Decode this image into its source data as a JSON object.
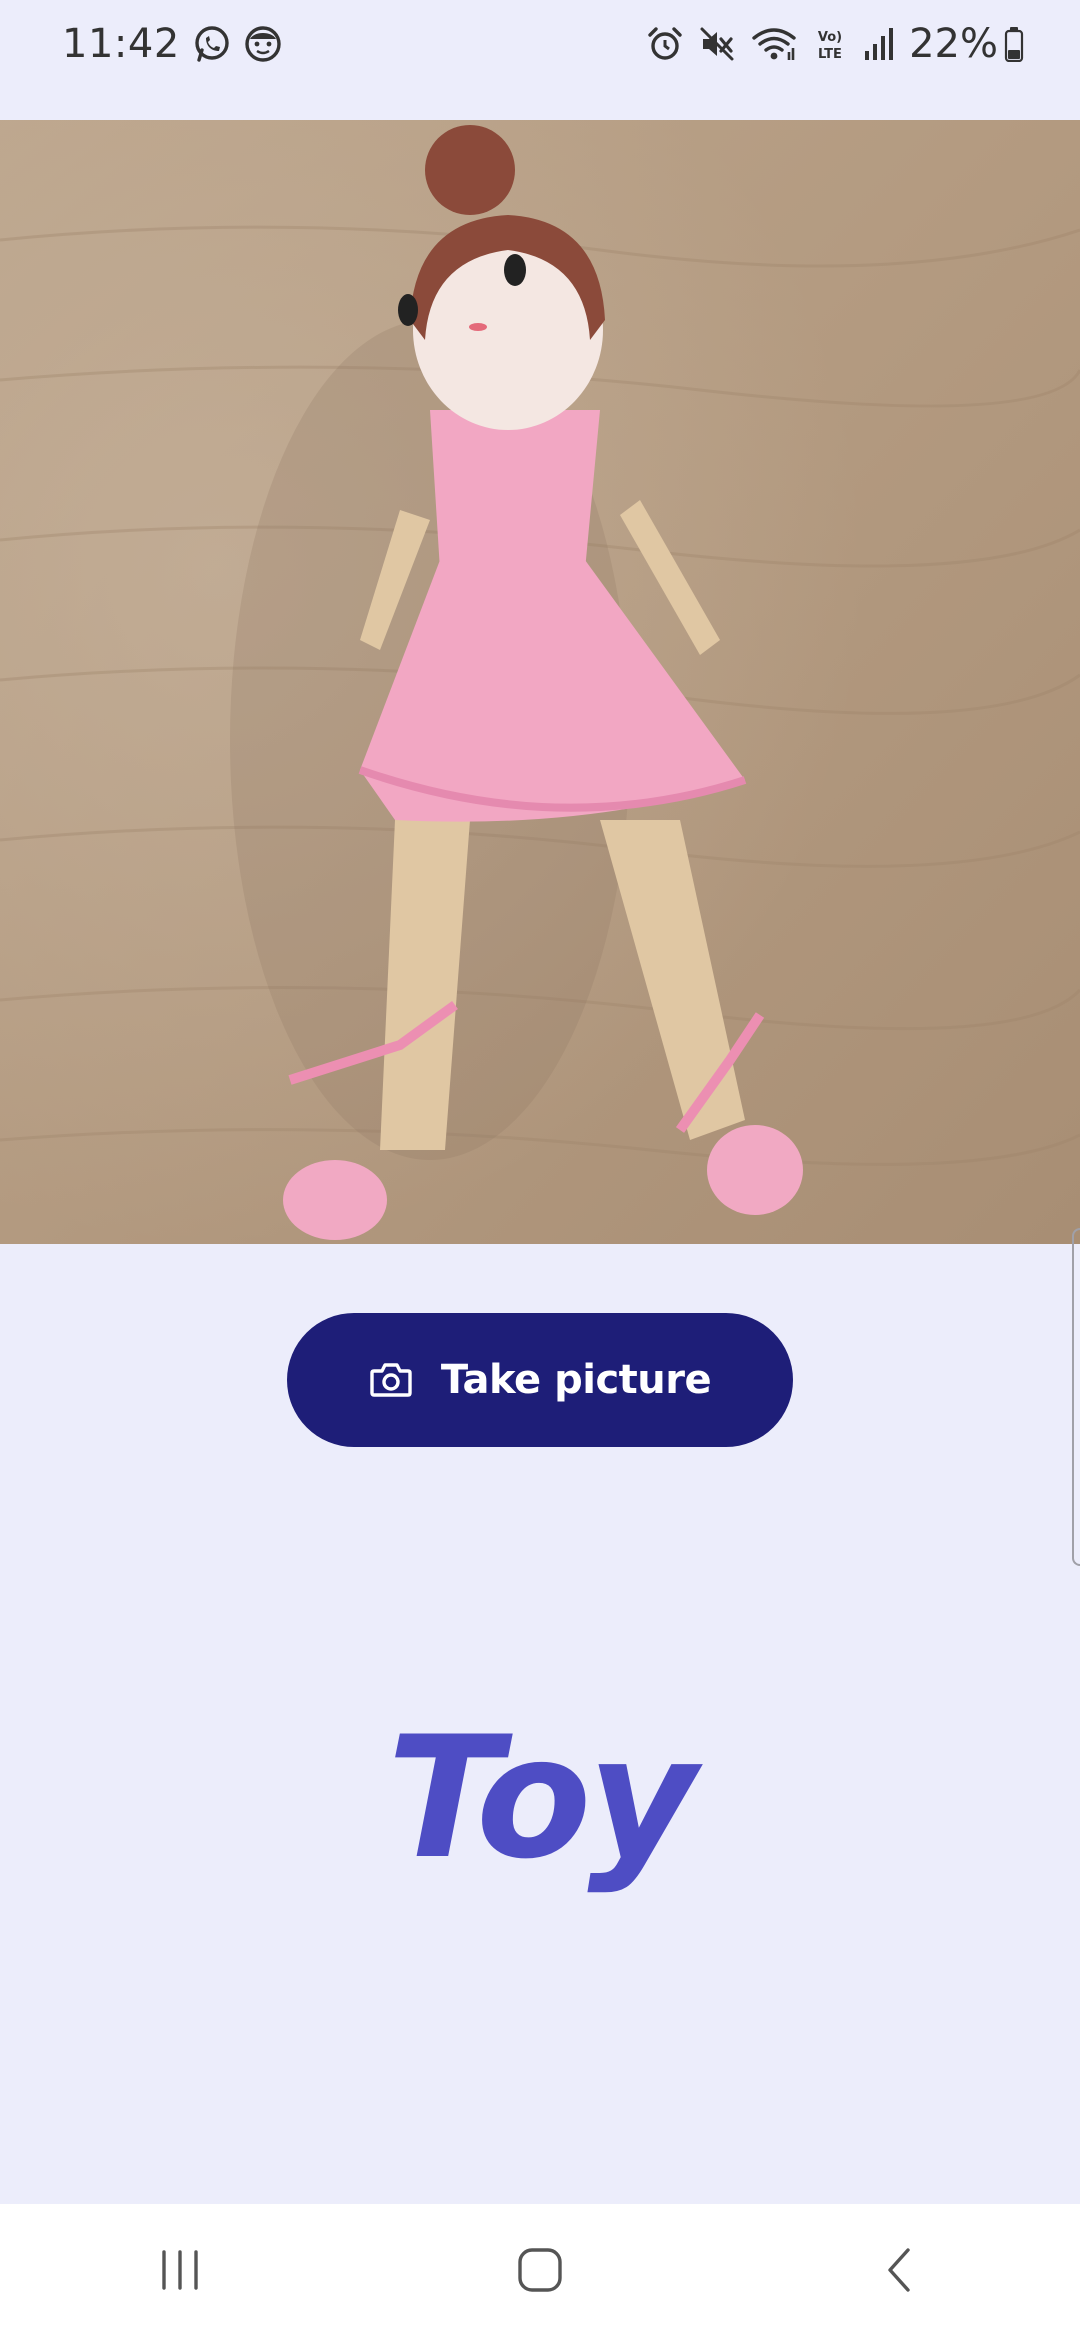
{
  "status_bar": {
    "time": "11:42",
    "battery_percent": "22%",
    "left_icons": [
      "whatsapp-icon",
      "face-notification-icon"
    ],
    "right_icons": [
      "alarm-icon",
      "mute-icon",
      "wifi-icon",
      "volte-icon",
      "signal-icon",
      "battery-icon"
    ]
  },
  "photo": {
    "subject": "crochet ballerina doll",
    "colors": {
      "background": "#B59C83",
      "dress": "#F2A7C3",
      "skin": "#E3C9A6",
      "hair": "#8B4A3A"
    }
  },
  "camera_button": {
    "label": "Take picture",
    "icon": "camera-icon",
    "color": "#1E1E78"
  },
  "result": {
    "label": "Toy",
    "color": "#4E4DC4"
  },
  "nav_bar": {
    "buttons": [
      "recent-apps-icon",
      "home-icon",
      "back-icon"
    ]
  },
  "theme": {
    "background": "#ECEDFB"
  }
}
